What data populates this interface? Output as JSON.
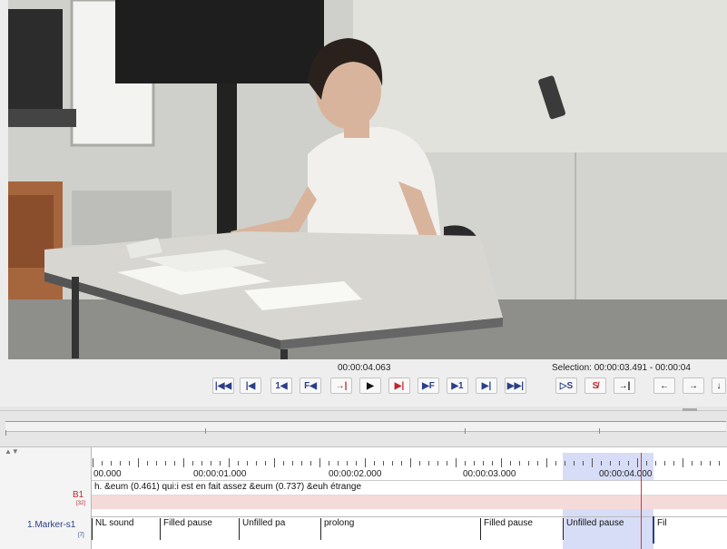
{
  "player": {
    "current_time": "00:00:04.063",
    "selection_label": "Selection: 00:00:03.491 - 00:00:04"
  },
  "transport": [
    {
      "name": "go-to-begin-button",
      "glyph": "|◀◀",
      "color": "blue"
    },
    {
      "name": "previous-scrollview-button",
      "glyph": "|◀",
      "color": "blue"
    },
    {
      "name": "previous-pixel-button",
      "glyph": "1◀",
      "color": "blue"
    },
    {
      "name": "previous-frame-button",
      "glyph": "F◀",
      "color": "blue"
    },
    {
      "name": "play-selection-reverse-button",
      "glyph": "→|",
      "color": "red"
    },
    {
      "name": "play-button",
      "glyph": "▶",
      "color": "black"
    },
    {
      "name": "play-selection-button",
      "glyph": "▶|",
      "color": "red"
    },
    {
      "name": "next-frame-button",
      "glyph": "▶F",
      "color": "blue"
    },
    {
      "name": "next-pixel-button",
      "glyph": "▶1",
      "color": "blue"
    },
    {
      "name": "next-scrollview-button",
      "glyph": "▶|",
      "color": "blue"
    },
    {
      "name": "go-to-end-button",
      "glyph": "▶▶|",
      "color": "blue"
    }
  ],
  "selection_tools": [
    {
      "name": "selection-mode-button",
      "glyph": "▷S",
      "color": "blue"
    },
    {
      "name": "clear-selection-button",
      "glyph": "S̸",
      "color": "red"
    },
    {
      "name": "active-selection-boundary-button",
      "glyph": "→|",
      "color": "black"
    },
    {
      "name": "previous-annotation-button",
      "glyph": "←",
      "color": "black"
    },
    {
      "name": "next-annotation-button",
      "glyph": "→",
      "color": "black"
    },
    {
      "name": "down-tier-button",
      "glyph": "↓",
      "color": "black"
    }
  ],
  "timeline": {
    "ticks": [
      "00.000",
      "00:00:01.000",
      "00:00:02.000",
      "00:00:03.000",
      "00:00:04.000"
    ]
  },
  "tiers": {
    "tier1_name": "B1",
    "tier1_count": "[32]",
    "tier1_text": "h. &eum (0.461) qui:i est en fait assez &eum (0.737) &euh étrange",
    "tier2_name": "1.Marker-s1",
    "tier2_count": "[7]"
  },
  "markers": [
    {
      "label": "NL sound"
    },
    {
      "label": "Filled pause"
    },
    {
      "label": "Unfilled pa"
    },
    {
      "label": "prolong"
    },
    {
      "label": "Filled pause"
    },
    {
      "label": "Unfilled pause"
    },
    {
      "label": "Fil"
    }
  ],
  "colors": {
    "accent_blue": "#2a3f86",
    "accent_red": "#c0282e",
    "selection": "#d7ddf6",
    "crosshair": "#e0303a",
    "tier1_bg": "#f5dada"
  }
}
